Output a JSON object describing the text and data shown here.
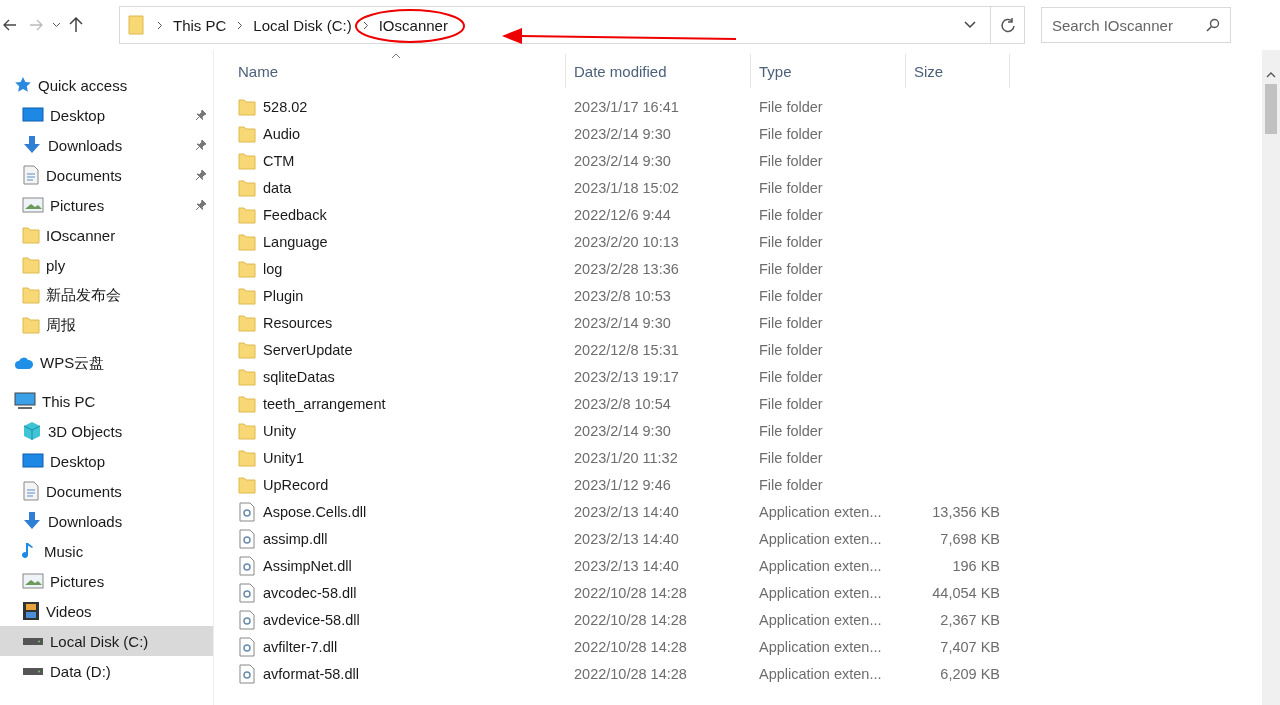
{
  "address_bar": {
    "crumbs": [
      "This PC",
      "Local Disk (C:)",
      "IOscanner"
    ]
  },
  "search": {
    "placeholder": "Search IOscanner"
  },
  "sidebar": {
    "sections": [
      {
        "label": "Quick access",
        "kind": "star",
        "selected": false,
        "children": [
          {
            "label": "Desktop",
            "kind": "desktop",
            "pinned": true,
            "selected": false
          },
          {
            "label": "Downloads",
            "kind": "download",
            "pinned": true,
            "selected": false
          },
          {
            "label": "Documents",
            "kind": "document",
            "pinned": true,
            "selected": false
          },
          {
            "label": "Pictures",
            "kind": "picture",
            "pinned": true,
            "selected": false
          },
          {
            "label": "IOscanner",
            "kind": "folder",
            "pinned": false,
            "selected": false
          },
          {
            "label": "ply",
            "kind": "folder",
            "pinned": false,
            "selected": false
          },
          {
            "label": "新品发布会",
            "kind": "folder",
            "pinned": false,
            "selected": false
          },
          {
            "label": "周报",
            "kind": "folder",
            "pinned": false,
            "selected": false
          }
        ]
      },
      {
        "label": "WPS云盘",
        "kind": "cloud",
        "selected": false
      },
      {
        "label": "This PC",
        "kind": "pc",
        "selected": false,
        "children": [
          {
            "label": "3D Objects",
            "kind": "cube",
            "pinned": false,
            "selected": false
          },
          {
            "label": "Desktop",
            "kind": "desktop",
            "pinned": false,
            "selected": false
          },
          {
            "label": "Documents",
            "kind": "document",
            "pinned": false,
            "selected": false
          },
          {
            "label": "Downloads",
            "kind": "download",
            "pinned": false,
            "selected": false
          },
          {
            "label": "Music",
            "kind": "music",
            "pinned": false,
            "selected": false
          },
          {
            "label": "Pictures",
            "kind": "picture",
            "pinned": false,
            "selected": false
          },
          {
            "label": "Videos",
            "kind": "video",
            "pinned": false,
            "selected": false
          },
          {
            "label": "Local Disk (C:)",
            "kind": "drive",
            "pinned": false,
            "selected": true
          },
          {
            "label": "Data (D:)",
            "kind": "drive",
            "pinned": false,
            "selected": false
          }
        ]
      }
    ]
  },
  "table": {
    "columns": [
      "Name",
      "Date modified",
      "Type",
      "Size"
    ],
    "rows": [
      {
        "kind": "folder",
        "name": "528.02",
        "date": "2023/1/17 16:41",
        "type": "File folder"
      },
      {
        "kind": "folder",
        "name": "Audio",
        "date": "2023/2/14 9:30",
        "type": "File folder"
      },
      {
        "kind": "folder",
        "name": "CTM",
        "date": "2023/2/14 9:30",
        "type": "File folder"
      },
      {
        "kind": "folder",
        "name": "data",
        "date": "2023/1/18 15:02",
        "type": "File folder"
      },
      {
        "kind": "folder",
        "name": "Feedback",
        "date": "2022/12/6 9:44",
        "type": "File folder"
      },
      {
        "kind": "folder",
        "name": "Language",
        "date": "2023/2/20 10:13",
        "type": "File folder"
      },
      {
        "kind": "folder",
        "name": "log",
        "date": "2023/2/28 13:36",
        "type": "File folder"
      },
      {
        "kind": "folder",
        "name": "Plugin",
        "date": "2023/2/8 10:53",
        "type": "File folder"
      },
      {
        "kind": "folder",
        "name": "Resources",
        "date": "2023/2/14 9:30",
        "type": "File folder"
      },
      {
        "kind": "folder",
        "name": "ServerUpdate",
        "date": "2022/12/8 15:31",
        "type": "File folder"
      },
      {
        "kind": "folder",
        "name": "sqliteDatas",
        "date": "2023/2/13 19:17",
        "type": "File folder"
      },
      {
        "kind": "folder",
        "name": "teeth_arrangement",
        "date": "2023/2/8 10:54",
        "type": "File folder"
      },
      {
        "kind": "folder",
        "name": "Unity",
        "date": "2023/2/14 9:30",
        "type": "File folder"
      },
      {
        "kind": "folder",
        "name": "Unity1",
        "date": "2023/1/20 11:32",
        "type": "File folder"
      },
      {
        "kind": "folder",
        "name": "UpRecord",
        "date": "2023/1/12 9:46",
        "type": "File folder"
      },
      {
        "kind": "dll",
        "name": "Aspose.Cells.dll",
        "date": "2023/2/13 14:40",
        "type": "Application exten...",
        "size": "13,356 KB"
      },
      {
        "kind": "dll",
        "name": "assimp.dll",
        "date": "2023/2/13 14:40",
        "type": "Application exten...",
        "size": "7,698 KB"
      },
      {
        "kind": "dll",
        "name": "AssimpNet.dll",
        "date": "2023/2/13 14:40",
        "type": "Application exten...",
        "size": "196 KB"
      },
      {
        "kind": "dll",
        "name": "avcodec-58.dll",
        "date": "2022/10/28 14:28",
        "type": "Application exten...",
        "size": "44,054 KB"
      },
      {
        "kind": "dll",
        "name": "avdevice-58.dll",
        "date": "2022/10/28 14:28",
        "type": "Application exten...",
        "size": "2,367 KB"
      },
      {
        "kind": "dll",
        "name": "avfilter-7.dll",
        "date": "2022/10/28 14:28",
        "type": "Application exten...",
        "size": "7,407 KB"
      },
      {
        "kind": "dll",
        "name": "avformat-58.dll",
        "date": "2022/10/28 14:28",
        "type": "Application exten...",
        "size": "6,209 KB"
      }
    ]
  }
}
